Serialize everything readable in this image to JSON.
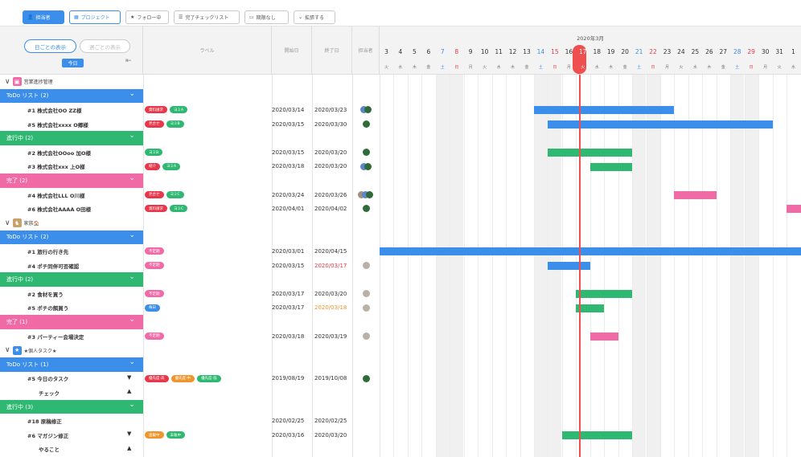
{
  "toolbar": {
    "buttons": [
      {
        "label": "担当者",
        "icon": "person-icon",
        "state": "on"
      },
      {
        "label": "プロジェクト",
        "icon": "grid-icon",
        "state": "out"
      },
      {
        "label": "フォロー中",
        "icon": "star-icon",
        "state": ""
      },
      {
        "label": "完了チェックリスト",
        "icon": "list-icon",
        "state": ""
      },
      {
        "label": "期限なし",
        "icon": "calendar-icon",
        "state": ""
      },
      {
        "label": "拡張する",
        "icon": "chevron-down-icon",
        "state": ""
      }
    ]
  },
  "left_header": {
    "view_by_group": "日ごとの表示",
    "view_by_week": "週ごとの表示",
    "today": "今日"
  },
  "columns": {
    "label": "ラベル",
    "start": "開始日",
    "end": "終了日",
    "assignee": "担当者"
  },
  "timeline": {
    "month": "2020年3月",
    "days": [
      {
        "d": "3",
        "w": "火"
      },
      {
        "d": "4",
        "w": "水"
      },
      {
        "d": "5",
        "w": "木"
      },
      {
        "d": "6",
        "w": "金"
      },
      {
        "d": "7",
        "w": "土",
        "t": "sat"
      },
      {
        "d": "8",
        "w": "日",
        "t": "sun"
      },
      {
        "d": "9",
        "w": "月"
      },
      {
        "d": "10",
        "w": "火"
      },
      {
        "d": "11",
        "w": "水"
      },
      {
        "d": "12",
        "w": "木"
      },
      {
        "d": "13",
        "w": "金"
      },
      {
        "d": "14",
        "w": "土",
        "t": "sat"
      },
      {
        "d": "15",
        "w": "日",
        "t": "sun"
      },
      {
        "d": "16",
        "w": "月"
      },
      {
        "d": "17",
        "w": "火",
        "t": "today"
      },
      {
        "d": "18",
        "w": "水"
      },
      {
        "d": "19",
        "w": "木"
      },
      {
        "d": "20",
        "w": "金"
      },
      {
        "d": "21",
        "w": "土",
        "t": "sat"
      },
      {
        "d": "22",
        "w": "日",
        "t": "sun"
      },
      {
        "d": "23",
        "w": "月"
      },
      {
        "d": "24",
        "w": "火"
      },
      {
        "d": "25",
        "w": "水"
      },
      {
        "d": "26",
        "w": "木"
      },
      {
        "d": "27",
        "w": "金"
      },
      {
        "d": "28",
        "w": "土",
        "t": "sat"
      },
      {
        "d": "29",
        "w": "日",
        "t": "sun"
      },
      {
        "d": "30",
        "w": "月"
      },
      {
        "d": "31",
        "w": "火"
      },
      {
        "d": "1",
        "w": "水"
      }
    ]
  },
  "colors": {
    "blue": "#3b8eea",
    "green": "#2eb872",
    "pink": "#f06aa6",
    "red": "#e8374a",
    "orange": "#f0952e",
    "accent": "#3b8eea"
  },
  "rows": [
    {
      "type": "project",
      "title": "営業進捗管理",
      "icon": "briefcase-icon",
      "icon_color": "#f06aa6"
    },
    {
      "type": "section",
      "title": "ToDo リスト (2)",
      "color": "blue"
    },
    {
      "type": "task",
      "title": "#1 株式会社OO ZZ様",
      "tags": [
        {
          "t": "資料請求",
          "c": "red"
        },
        {
          "t": "ヨミA",
          "c": "green"
        }
      ],
      "start": "2020/03/14",
      "end": "2020/03/23",
      "avatars": 2,
      "bar": {
        "start": "2020/03/14",
        "end": "2020/03/23",
        "color": "blue"
      }
    },
    {
      "type": "task",
      "title": "#5 株式会社xxxx O郷様",
      "tags": [
        {
          "t": "見合せ",
          "c": "red"
        },
        {
          "t": "ヨミB",
          "c": "green"
        }
      ],
      "start": "2020/03/15",
      "end": "2020/03/30",
      "avatars": 1,
      "bar": {
        "start": "2020/03/15",
        "end": "2020/03/30",
        "color": "blue"
      }
    },
    {
      "type": "section",
      "title": "進行中 (2)",
      "color": "green"
    },
    {
      "type": "task",
      "title": "#2 株式会社OOoo 加O様",
      "tags": [
        {
          "t": "ヨミB",
          "c": "green"
        }
      ],
      "start": "2020/03/15",
      "end": "2020/03/20",
      "avatars": 1,
      "bar": {
        "start": "2020/03/15",
        "end": "2020/03/20",
        "color": "green"
      }
    },
    {
      "type": "task",
      "title": "#3 株式会社xxx 上O様",
      "tags": [
        {
          "t": "紹介",
          "c": "red"
        },
        {
          "t": "ヨミA",
          "c": "green"
        }
      ],
      "start": "2020/03/18",
      "end": "2020/03/20",
      "avatars": 2,
      "bar": {
        "start": "2020/03/18",
        "end": "2020/03/20",
        "color": "green"
      }
    },
    {
      "type": "section",
      "title": "完了 (2)",
      "color": "pink"
    },
    {
      "type": "task",
      "title": "#4 株式会社LLL O川様",
      "tags": [
        {
          "t": "見合せ",
          "c": "red"
        },
        {
          "t": "ヨミC",
          "c": "green"
        }
      ],
      "start": "2020/03/24",
      "end": "2020/03/26",
      "avatars": 3,
      "bar": {
        "start": "2020/03/24",
        "end": "2020/03/26",
        "color": "pink"
      }
    },
    {
      "type": "task",
      "title": "#6 株式会社AAAA O田様",
      "tags": [
        {
          "t": "資料請求",
          "c": "red"
        },
        {
          "t": "ヨミC",
          "c": "green"
        }
      ],
      "start": "2020/04/01",
      "end": "2020/04/02",
      "avatars": 1,
      "bar": {
        "start": "2020/04/01",
        "end": "2020/04/02",
        "color": "pink"
      }
    },
    {
      "type": "project",
      "title": "家族🏠",
      "icon": "dog-icon",
      "icon_color": "#c9a26a"
    },
    {
      "type": "section",
      "title": "ToDo リスト (2)",
      "color": "blue"
    },
    {
      "type": "task",
      "title": "#1 旅行の行き先",
      "tags": [
        {
          "t": "不定期",
          "c": "pink"
        }
      ],
      "start": "2020/03/01",
      "end": "2020/04/15",
      "avatars": 0,
      "bar": {
        "start": "2020/03/01",
        "end": "2020/04/15",
        "color": "blue"
      }
    },
    {
      "type": "task",
      "title": "#4 ポチ同伴可否確認",
      "tags": [
        {
          "t": "不定期",
          "c": "pink"
        }
      ],
      "start": "2020/03/15",
      "end": "2020/03/17",
      "end_color": "red",
      "avatars": 1,
      "bar": {
        "start": "2020/03/15",
        "end": "2020/03/17",
        "color": "blue"
      }
    },
    {
      "type": "section",
      "title": "進行中 (2)",
      "color": "green"
    },
    {
      "type": "task",
      "title": "#2 食材を買う",
      "tags": [
        {
          "t": "不定期",
          "c": "pink"
        }
      ],
      "start": "2020/03/17",
      "end": "2020/03/20",
      "avatars": 1,
      "bar": {
        "start": "2020/03/17",
        "end": "2020/03/20",
        "color": "green"
      }
    },
    {
      "type": "task",
      "title": "#5 ポチの餌買う",
      "tags": [
        {
          "t": "毎日",
          "c": "blue"
        }
      ],
      "start": "2020/03/17",
      "end": "2020/03/18",
      "end_color": "orange",
      "avatars": 1,
      "bar": {
        "start": "2020/03/17",
        "end": "2020/03/18",
        "color": "green"
      }
    },
    {
      "type": "section",
      "title": "完了 (1)",
      "color": "pink"
    },
    {
      "type": "task",
      "title": "#3 パーティー会場決定",
      "tags": [
        {
          "t": "不定期",
          "c": "pink"
        }
      ],
      "start": "2020/03/18",
      "end": "2020/03/19",
      "avatars": 1,
      "bar": {
        "start": "2020/03/18",
        "end": "2020/03/19",
        "color": "pink"
      }
    },
    {
      "type": "project",
      "title": "★個人タスク★",
      "icon": "star-icon",
      "icon_color": "#3b8eea"
    },
    {
      "type": "section",
      "title": "ToDo リスト (1)",
      "color": "blue"
    },
    {
      "type": "task",
      "title": "#5 今日のタスク",
      "tri": "▼",
      "tags": [
        {
          "t": "優先度:高",
          "c": "red"
        },
        {
          "t": "優先度:中",
          "c": "orange"
        },
        {
          "t": "優先度:低",
          "c": "green"
        }
      ],
      "start": "2019/08/19",
      "end": "2019/10/08",
      "avatars": 1
    },
    {
      "type": "sub",
      "title": "チェック",
      "tri": "▲"
    },
    {
      "type": "section",
      "title": "進行中 (3)",
      "color": "green"
    },
    {
      "type": "task",
      "title": "#18 原稿修正",
      "tags": [],
      "start": "2020/02/25",
      "end": "2020/02/25",
      "avatars": 0
    },
    {
      "type": "task",
      "title": "#6 マガジン修正",
      "tri": "▼",
      "tags": [
        {
          "t": "連載中",
          "c": "orange"
        },
        {
          "t": "未執中",
          "c": "green"
        }
      ],
      "start": "2020/03/16",
      "end": "2020/03/20",
      "avatars": 0,
      "bar": {
        "start": "2020/03/16",
        "end": "2020/03/20",
        "color": "green"
      }
    },
    {
      "type": "sub",
      "title": "やること",
      "tri": "▲"
    }
  ]
}
